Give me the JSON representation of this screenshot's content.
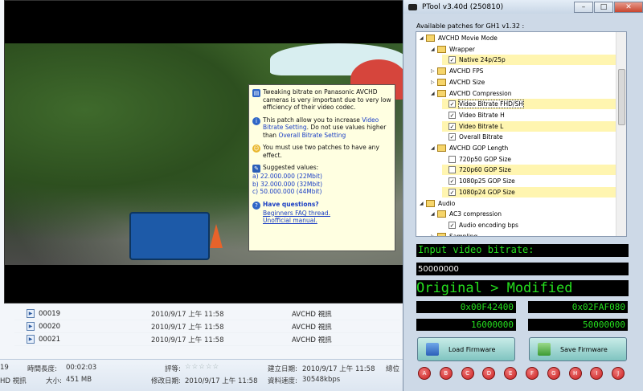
{
  "explorer": {
    "files": [
      {
        "name": "00019",
        "date": "2010/9/17 上午 11:58",
        "type": "AVCHD 視訊"
      },
      {
        "name": "00020",
        "date": "2010/9/17 上午 11:58",
        "type": "AVCHD 視訊"
      },
      {
        "name": "00021",
        "date": "2010/9/17 上午 11:58",
        "type": "AVCHD 視訊"
      }
    ],
    "details": {
      "left_num": "19",
      "left_type": "HD 視訊",
      "duration_label": "時間長度:",
      "duration": "00:02:03",
      "size_label": "大小:",
      "size": "451 MB",
      "rating_label": "評等:",
      "stars": "☆☆☆☆☆",
      "modified_label": "修改日期:",
      "modified": "2010/9/17 上午 11:58",
      "created_label": "建立日期:",
      "created": "2010/9/17 上午 11:58",
      "rate_label": "資料速度:",
      "rate": "30548kbps",
      "extra": "總位"
    }
  },
  "tooltip": {
    "p1": "Tweaking bitrate on Panasonic AVCHD cameras is very important due to very low efficiency of their video codec.",
    "p2a": "This patch allow you to increase ",
    "p2_link1": "Video Bitrate Setting",
    "p2b": ". Do not use values higher than ",
    "p2_link2": "Overall Bitrate Setting",
    "p3": "You must use two patches to have any effect.",
    "p4_title": "Suggested values:",
    "p4_a": "a) 22.000.000 (22Mbit)",
    "p4_b": "b) 32.000.000 (32Mbit)",
    "p4_c": "c) 50.000.000 (44Mbit)",
    "q_title": "Have questions?",
    "q_link1": "Beginners FAQ thread.",
    "q_link2": "Unofficial manual."
  },
  "ptool": {
    "title": "PTool v3.40d (250810)",
    "min": "–",
    "max": "□",
    "close": "✕",
    "patches_label": "Available patches for GH1 v1.32 :",
    "tree": [
      {
        "label": "AVCHD Movie Mode",
        "kind": "book",
        "tri": "◢",
        "indent": 0
      },
      {
        "label": "Wrapper",
        "kind": "book",
        "tri": "◢",
        "indent": 1
      },
      {
        "label": "Native 24p/25p",
        "kind": "check",
        "checked": true,
        "indent": 2
      },
      {
        "label": "AVCHD FPS",
        "kind": "book",
        "tri": "▷",
        "indent": 1
      },
      {
        "label": "AVCHD Size",
        "kind": "book",
        "tri": "▷",
        "indent": 1
      },
      {
        "label": "AVCHD Compression",
        "kind": "book",
        "tri": "◢",
        "indent": 1
      },
      {
        "label": "Video Bitrate FHD/SH",
        "kind": "check",
        "checked": true,
        "indent": 2,
        "selected": true
      },
      {
        "label": "Video Bitrate H",
        "kind": "check",
        "checked": true,
        "indent": 2
      },
      {
        "label": "Video Bitrate L",
        "kind": "check",
        "checked": true,
        "indent": 2
      },
      {
        "label": "Overall Bitrate",
        "kind": "check",
        "checked": true,
        "indent": 2
      },
      {
        "label": "AVCHD GOP Length",
        "kind": "book",
        "tri": "◢",
        "indent": 1
      },
      {
        "label": "720p50 GOP Size",
        "kind": "check",
        "checked": false,
        "indent": 2
      },
      {
        "label": "720p60 GOP Size",
        "kind": "check",
        "checked": false,
        "indent": 2
      },
      {
        "label": "1080p25 GOP Size",
        "kind": "check",
        "checked": true,
        "indent": 2
      },
      {
        "label": "1080p24 GOP Size",
        "kind": "check",
        "checked": true,
        "indent": 2
      },
      {
        "label": "Audio",
        "kind": "book",
        "tri": "◢",
        "indent": 0
      },
      {
        "label": "AC3 compression",
        "kind": "book",
        "tri": "◢",
        "indent": 1
      },
      {
        "label": "Audio encoding bps",
        "kind": "check",
        "checked": true,
        "indent": 2
      },
      {
        "label": "Sampling",
        "kind": "book",
        "tri": "▷",
        "indent": 1
      }
    ],
    "lcd_label": "Input video bitrate:",
    "input_value": "50000000",
    "lcd_header": "Original > Modified",
    "hex_orig": "0x00F42400",
    "hex_mod": "0x02FAF080",
    "dec_orig": "16000000",
    "dec_mod": "50000000",
    "load_btn": "Load Firmware",
    "save_btn": "Save Firmware",
    "slots": [
      "A",
      "B",
      "C",
      "D",
      "E",
      "F",
      "G",
      "H",
      "I",
      "J"
    ]
  },
  "colors": {
    "lcd_green": "#25e01e",
    "accent_link": "#1a3ec4",
    "slot_red": "#c81d1d"
  }
}
